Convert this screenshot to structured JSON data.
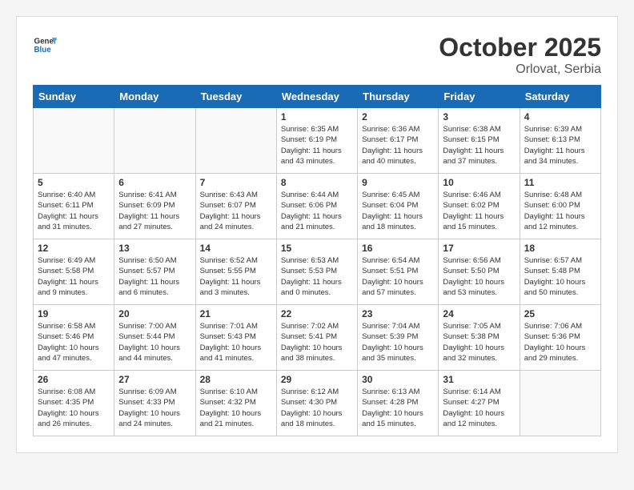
{
  "header": {
    "logo_line1": "General",
    "logo_line2": "Blue",
    "month_title": "October 2025",
    "location": "Orlovat, Serbia"
  },
  "days_of_week": [
    "Sunday",
    "Monday",
    "Tuesday",
    "Wednesday",
    "Thursday",
    "Friday",
    "Saturday"
  ],
  "weeks": [
    [
      {
        "day": "",
        "info": ""
      },
      {
        "day": "",
        "info": ""
      },
      {
        "day": "",
        "info": ""
      },
      {
        "day": "1",
        "info": "Sunrise: 6:35 AM\nSunset: 6:19 PM\nDaylight: 11 hours\nand 43 minutes."
      },
      {
        "day": "2",
        "info": "Sunrise: 6:36 AM\nSunset: 6:17 PM\nDaylight: 11 hours\nand 40 minutes."
      },
      {
        "day": "3",
        "info": "Sunrise: 6:38 AM\nSunset: 6:15 PM\nDaylight: 11 hours\nand 37 minutes."
      },
      {
        "day": "4",
        "info": "Sunrise: 6:39 AM\nSunset: 6:13 PM\nDaylight: 11 hours\nand 34 minutes."
      }
    ],
    [
      {
        "day": "5",
        "info": "Sunrise: 6:40 AM\nSunset: 6:11 PM\nDaylight: 11 hours\nand 31 minutes."
      },
      {
        "day": "6",
        "info": "Sunrise: 6:41 AM\nSunset: 6:09 PM\nDaylight: 11 hours\nand 27 minutes."
      },
      {
        "day": "7",
        "info": "Sunrise: 6:43 AM\nSunset: 6:07 PM\nDaylight: 11 hours\nand 24 minutes."
      },
      {
        "day": "8",
        "info": "Sunrise: 6:44 AM\nSunset: 6:06 PM\nDaylight: 11 hours\nand 21 minutes."
      },
      {
        "day": "9",
        "info": "Sunrise: 6:45 AM\nSunset: 6:04 PM\nDaylight: 11 hours\nand 18 minutes."
      },
      {
        "day": "10",
        "info": "Sunrise: 6:46 AM\nSunset: 6:02 PM\nDaylight: 11 hours\nand 15 minutes."
      },
      {
        "day": "11",
        "info": "Sunrise: 6:48 AM\nSunset: 6:00 PM\nDaylight: 11 hours\nand 12 minutes."
      }
    ],
    [
      {
        "day": "12",
        "info": "Sunrise: 6:49 AM\nSunset: 5:58 PM\nDaylight: 11 hours\nand 9 minutes."
      },
      {
        "day": "13",
        "info": "Sunrise: 6:50 AM\nSunset: 5:57 PM\nDaylight: 11 hours\nand 6 minutes."
      },
      {
        "day": "14",
        "info": "Sunrise: 6:52 AM\nSunset: 5:55 PM\nDaylight: 11 hours\nand 3 minutes."
      },
      {
        "day": "15",
        "info": "Sunrise: 6:53 AM\nSunset: 5:53 PM\nDaylight: 11 hours\nand 0 minutes."
      },
      {
        "day": "16",
        "info": "Sunrise: 6:54 AM\nSunset: 5:51 PM\nDaylight: 10 hours\nand 57 minutes."
      },
      {
        "day": "17",
        "info": "Sunrise: 6:56 AM\nSunset: 5:50 PM\nDaylight: 10 hours\nand 53 minutes."
      },
      {
        "day": "18",
        "info": "Sunrise: 6:57 AM\nSunset: 5:48 PM\nDaylight: 10 hours\nand 50 minutes."
      }
    ],
    [
      {
        "day": "19",
        "info": "Sunrise: 6:58 AM\nSunset: 5:46 PM\nDaylight: 10 hours\nand 47 minutes."
      },
      {
        "day": "20",
        "info": "Sunrise: 7:00 AM\nSunset: 5:44 PM\nDaylight: 10 hours\nand 44 minutes."
      },
      {
        "day": "21",
        "info": "Sunrise: 7:01 AM\nSunset: 5:43 PM\nDaylight: 10 hours\nand 41 minutes."
      },
      {
        "day": "22",
        "info": "Sunrise: 7:02 AM\nSunset: 5:41 PM\nDaylight: 10 hours\nand 38 minutes."
      },
      {
        "day": "23",
        "info": "Sunrise: 7:04 AM\nSunset: 5:39 PM\nDaylight: 10 hours\nand 35 minutes."
      },
      {
        "day": "24",
        "info": "Sunrise: 7:05 AM\nSunset: 5:38 PM\nDaylight: 10 hours\nand 32 minutes."
      },
      {
        "day": "25",
        "info": "Sunrise: 7:06 AM\nSunset: 5:36 PM\nDaylight: 10 hours\nand 29 minutes."
      }
    ],
    [
      {
        "day": "26",
        "info": "Sunrise: 6:08 AM\nSunset: 4:35 PM\nDaylight: 10 hours\nand 26 minutes."
      },
      {
        "day": "27",
        "info": "Sunrise: 6:09 AM\nSunset: 4:33 PM\nDaylight: 10 hours\nand 24 minutes."
      },
      {
        "day": "28",
        "info": "Sunrise: 6:10 AM\nSunset: 4:32 PM\nDaylight: 10 hours\nand 21 minutes."
      },
      {
        "day": "29",
        "info": "Sunrise: 6:12 AM\nSunset: 4:30 PM\nDaylight: 10 hours\nand 18 minutes."
      },
      {
        "day": "30",
        "info": "Sunrise: 6:13 AM\nSunset: 4:28 PM\nDaylight: 10 hours\nand 15 minutes."
      },
      {
        "day": "31",
        "info": "Sunrise: 6:14 AM\nSunset: 4:27 PM\nDaylight: 10 hours\nand 12 minutes."
      },
      {
        "day": "",
        "info": ""
      }
    ]
  ]
}
